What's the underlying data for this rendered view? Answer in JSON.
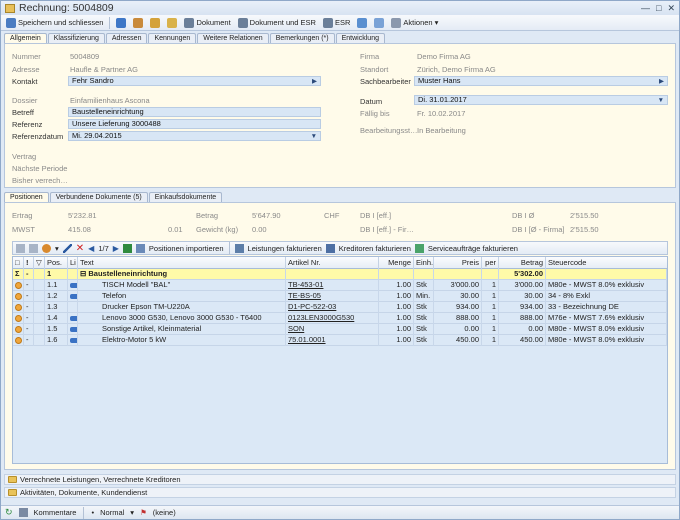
{
  "window": {
    "title": "Rechnung: 5004809"
  },
  "toolbar": {
    "save_close": "Speichern und schliessen",
    "dokument": "Dokument",
    "dokument_esr": "Dokument und ESR",
    "esr": "ESR",
    "aktionen": "Aktionen"
  },
  "tabs": [
    "Allgemein",
    "Klassifizierung",
    "Adressen",
    "Kennungen",
    "Weitere Relationen",
    "Bemerkungen (*)",
    "Entwicklung"
  ],
  "form": {
    "nummer_label": "Nummer",
    "nummer": "5004809",
    "adresse_label": "Adresse",
    "adresse": "Haufle & Partner AG",
    "kontakt_label": "Kontakt",
    "kontakt": "Fehr Sandro",
    "dossier_label": "Dossier",
    "dossier": "Einfamilienhaus Ascona",
    "betreff_label": "Betreff",
    "betreff": "Baustelleneinrichtung",
    "referenz_label": "Referenz",
    "referenz": "Unsere Lieferung 3000488",
    "referenzdatum_label": "Referenzdatum",
    "referenzdatum": "Mi. 29.04.2015",
    "vertrag_label": "Vertrag",
    "naechste_periode_label": "Nächste Periode",
    "bisher_label": "Bisher verrech…",
    "firma_label": "Firma",
    "firma": "Demo Firma AG",
    "standort_label": "Standort",
    "standort": "Zürich, Demo Firma AG",
    "sachbearbeiter_label": "Sachbearbeiter",
    "sachbearbeiter": "Muster Hans",
    "datum_label": "Datum",
    "datum": "Di. 31.01.2017",
    "faellig_label": "Fällig bis",
    "faellig": "Fr. 10.02.2017",
    "bearbeitung_label": "Bearbeitungsst…",
    "bearbeitung": "In Bearbeitung"
  },
  "subtabs": [
    "Positionen",
    "Verbundene Dokumente (5)",
    "Einkaufsdokumente"
  ],
  "summary": {
    "ertrag_label": "Ertrag",
    "ertrag": "5'232.81",
    "mwst_label": "MWST",
    "mwst": "415.08",
    "mwst_small": "0.01",
    "betrag_label": "Betrag",
    "betrag": "5'647.90",
    "currency": "CHF",
    "gewicht_label": "Gewicht (kg)",
    "gewicht": "0.00",
    "db_eff1": "DB I [eff.]",
    "db_eff2": "DB I [eff.] - Fir…",
    "db_avg1": "DB I Ø",
    "db_avg1_val": "2'515.50",
    "db_avg2": "DB I [Ø - Firma]",
    "db_avg2_val": "2'515.50"
  },
  "gridtoolbar": {
    "page": "1/7",
    "import": "Positionen importieren",
    "leistungen": "Leistungen fakturieren",
    "kreditoren": "Kreditoren fakturieren",
    "service": "Serviceaufträge fakturieren"
  },
  "grid": {
    "headers": [
      "Pos.",
      "Li",
      "Text",
      "Artikel Nr.",
      "Menge",
      "Einh.",
      "Preis",
      "per",
      "Betrag",
      "Steuercode"
    ],
    "group": {
      "pos": "1",
      "text": "Baustelleneinrichtung",
      "betrag": "5'302.00"
    },
    "rows": [
      {
        "pos": "1.1",
        "text": "TISCH Modell \"BAL\"",
        "art": "TB-453-01",
        "menge": "1.00",
        "einh": "Stk",
        "preis": "3'000.00",
        "per": "1",
        "betrag": "3'000.00",
        "steuer": "M80e - MWST 8.0% exklusiv",
        "car": true
      },
      {
        "pos": "1.2",
        "text": "Telefon",
        "art": "TE-BS-05",
        "menge": "1.00",
        "einh": "Min.",
        "preis": "30.00",
        "per": "1",
        "betrag": "30.00",
        "steuer": "34 - 8% Exkl",
        "car": true
      },
      {
        "pos": "1.3",
        "text": "Drucker Epson TM-U220A",
        "art": "D1-PC-522-03",
        "menge": "1.00",
        "einh": "Stk",
        "preis": "934.00",
        "per": "1",
        "betrag": "934.00",
        "steuer": "33 - Bezeichnung DE",
        "car": false
      },
      {
        "pos": "1.4",
        "text": "Lenovo 3000 G530, Lenovo 3000 G530 - T6400",
        "art": "0123LEN3000G530",
        "menge": "1.00",
        "einh": "Stk",
        "preis": "888.00",
        "per": "1",
        "betrag": "888.00",
        "steuer": "M76e - MWST 7.6% exklusiv",
        "car": true
      },
      {
        "pos": "1.5",
        "text": "Sonstige Artikel, Kleinmaterial",
        "art": "SON",
        "menge": "1.00",
        "einh": "Stk",
        "preis": "0.00",
        "per": "1",
        "betrag": "0.00",
        "steuer": "M80e - MWST 8.0% exklusiv",
        "car": true
      },
      {
        "pos": "1.6",
        "text": "Elektro-Motor 5 kW",
        "art": "75.01.0001",
        "menge": "1.00",
        "einh": "Stk",
        "preis": "450.00",
        "per": "1",
        "betrag": "450.00",
        "steuer": "M80e - MWST 8.0% exklusiv",
        "car": true
      }
    ]
  },
  "bottom": {
    "verrechnete": "Verrechnete Leistungen, Verrechnete Kreditoren",
    "aktivitaeten": "Aktivitäten, Dokumente, Kundendienst"
  },
  "statusbar": {
    "kommentare": "Kommentare",
    "normal": "Normal",
    "keine": "(keine)"
  },
  "colors": {
    "group_row": "#fffaa8",
    "field_bg": "#d8e6f5",
    "panel_bg": "#fffbea"
  }
}
